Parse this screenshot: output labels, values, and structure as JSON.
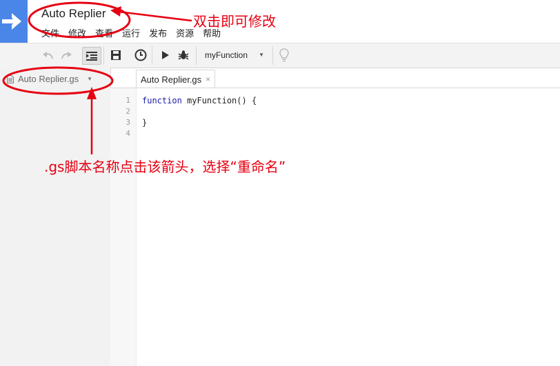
{
  "header": {
    "project_title": "Auto Replier",
    "menu": [
      "文件",
      "修改",
      "查看",
      "运行",
      "发布",
      "资源",
      "帮助"
    ]
  },
  "toolbar": {
    "function_select": "myFunction",
    "icons": [
      "undo-icon",
      "redo-icon",
      "indent-icon",
      "save-icon",
      "triggers-clock-icon",
      "run-play-icon",
      "debug-bug-icon",
      "lightbulb-icon"
    ]
  },
  "sidebar": {
    "file_name": "Auto Replier.gs"
  },
  "editor": {
    "tab_label": "Auto Replier.gs",
    "tab_close": "×",
    "line_numbers": [
      "1",
      "2",
      "3",
      "4"
    ],
    "code_lines": [
      {
        "kw": "function",
        "rest": " myFunction() {"
      },
      {
        "kw": "",
        "rest": ""
      },
      {
        "kw": "",
        "rest": "}"
      },
      {
        "kw": "",
        "rest": ""
      }
    ]
  },
  "annotations": {
    "title_note": "双击即可修改",
    "file_note": ".gs脚本名称点击该箭头，选择“重命名”",
    "color": "#e60012"
  },
  "colors": {
    "logo_blue": "#4a86e8",
    "annotation_red": "#e60012"
  }
}
